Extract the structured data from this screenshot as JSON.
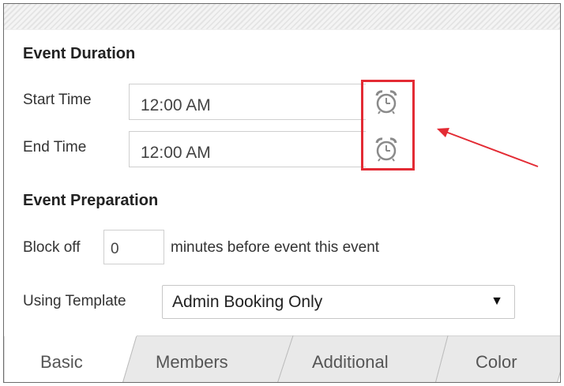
{
  "duration": {
    "title": "Event Duration",
    "start_label": "Start Time",
    "start_value": "12:00 AM",
    "end_label": "End Time",
    "end_value": "12:00 AM",
    "icon": "alarm-clock-icon"
  },
  "preparation": {
    "title": "Event Preparation",
    "block_label": "Block off",
    "block_value": "0",
    "block_suffix": "minutes before event this event",
    "template_label": "Using Template",
    "template_value": "Admin Booking Only"
  },
  "tabs": [
    {
      "label": "Basic",
      "active": true
    },
    {
      "label": "Members",
      "active": false
    },
    {
      "label": "Additional",
      "active": false
    },
    {
      "label": "Color",
      "active": false
    }
  ],
  "colors": {
    "highlight": "#e32b34",
    "arrow": "#e32b34",
    "tab_inactive": "#e9e9e9",
    "tab_active": "#ffffff"
  }
}
